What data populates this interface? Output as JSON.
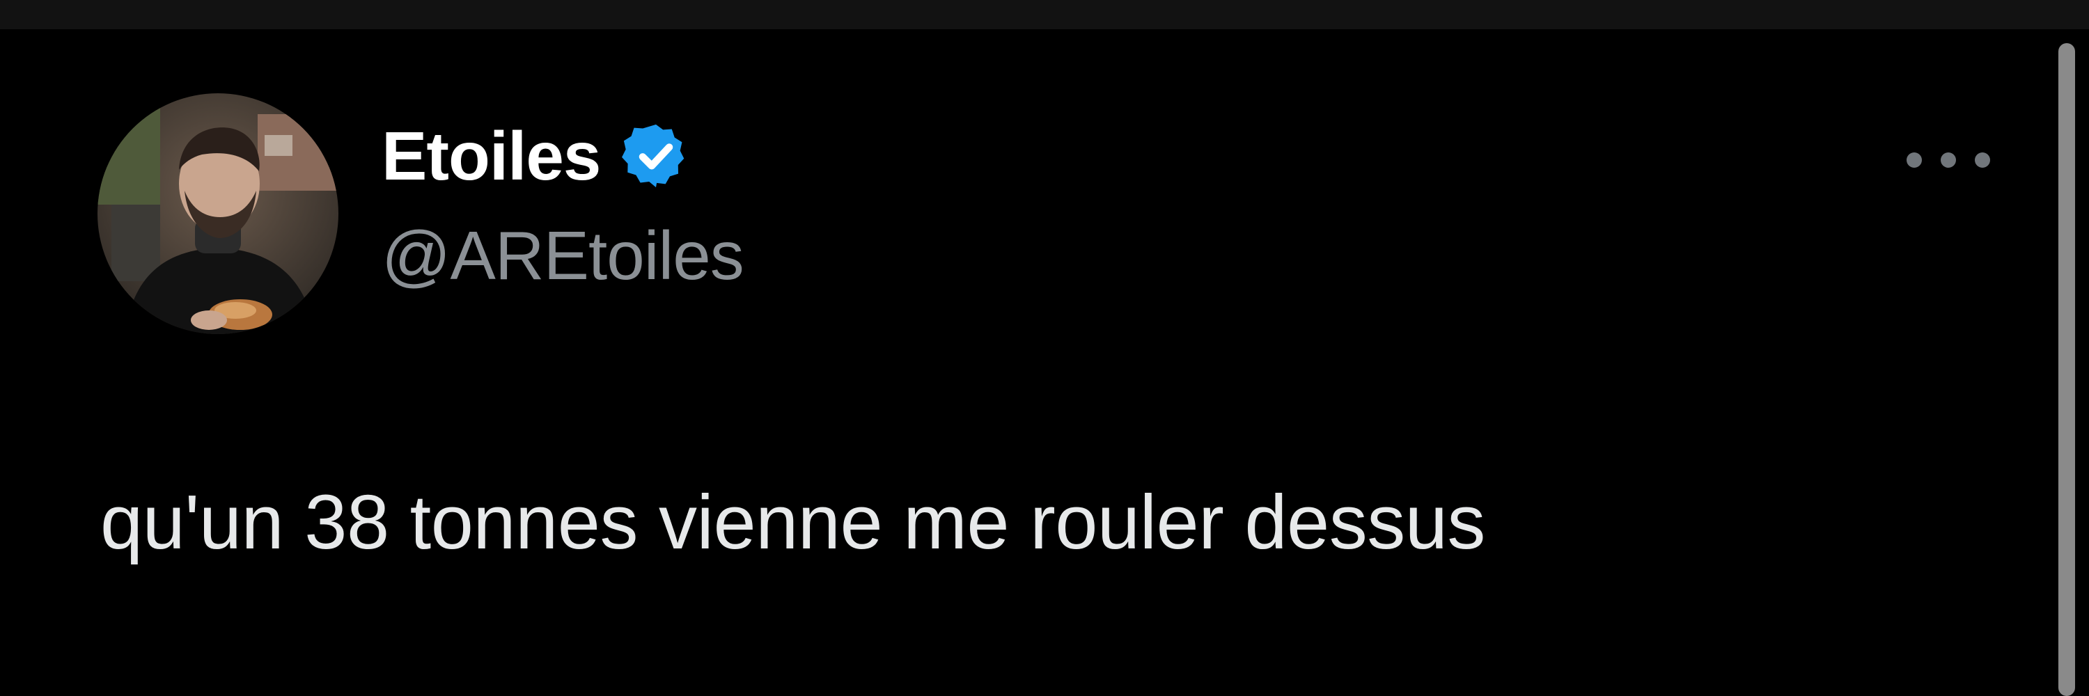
{
  "tweet": {
    "author": {
      "display_name": "Etoiles",
      "handle": "@AREtoiles",
      "verified": true,
      "avatar_icon": "profile-photo"
    },
    "text": "qu'un 38 tonnes vienne me rouler dessus",
    "more_icon": "more-options-icon"
  },
  "colors": {
    "background": "#000000",
    "top_strip": "#121212",
    "display_name": "#ffffff",
    "handle": "#8b9095",
    "tweet_text": "#e7e9ea",
    "verified_badge": "#1d9bf0",
    "more_dots": "#71767b",
    "scrollbar": "#8a8a8a"
  }
}
